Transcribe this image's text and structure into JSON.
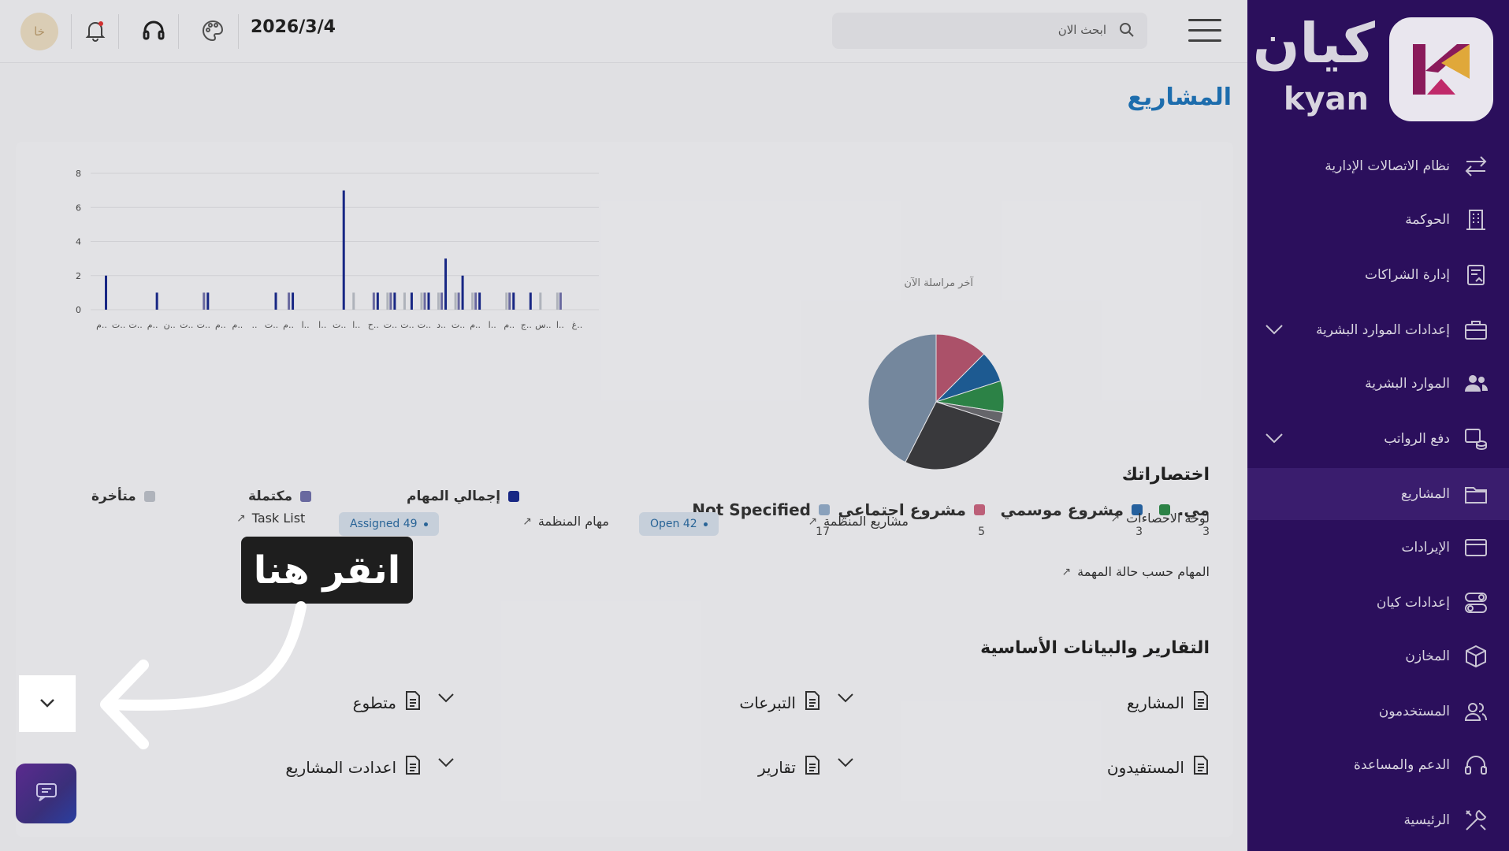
{
  "sidebar": {
    "logo_ar": "كيان",
    "logo_en": "kyan",
    "items": [
      {
        "label": "نظام الاتصالات الإدارية",
        "icon": "transfer-arrows-icon"
      },
      {
        "label": "الحوكمة",
        "icon": "building-icon"
      },
      {
        "label": "إدارة الشراكات",
        "icon": "document-house-icon"
      },
      {
        "label": "إعدادات الموارد البشرية",
        "icon": "briefcase-icon"
      },
      {
        "label": "الموارد البشرية",
        "icon": "users-icon"
      },
      {
        "label": "دفع الرواتب",
        "icon": "coins-icon"
      },
      {
        "label": "المشاريع",
        "icon": "folder-icon"
      },
      {
        "label": "الإيرادات",
        "icon": "card-icon"
      },
      {
        "label": "إعدادات كيان",
        "icon": "toggles-icon"
      },
      {
        "label": "المخازن",
        "icon": "box-icon"
      },
      {
        "label": "المستخدمون",
        "icon": "user-group-icon"
      },
      {
        "label": "الدعم والمساعدة",
        "icon": "headset-icon"
      },
      {
        "label": "الرئيسية",
        "icon": "tools-icon"
      }
    ]
  },
  "topbar": {
    "avatar_initials": "خا",
    "date": "2026/3/4",
    "search_placeholder": "ابحث الان"
  },
  "page": {
    "title": "المشاريع",
    "clipped_heading": "آخر مراسلة الآن"
  },
  "chart_data": [
    {
      "type": "bar",
      "ylim": [
        0,
        8
      ],
      "yticks": [
        "0",
        "2",
        "4",
        "6",
        "8"
      ],
      "categories": [
        "م..",
        "ت..",
        "ت..",
        "م..",
        "ن..",
        "ت..",
        "ت..",
        "م..",
        "م..",
        "..",
        "ت..",
        "م..",
        "ا..",
        "ا..",
        "ت..",
        "ا..",
        "ح..",
        "ت..",
        "ت..",
        "ت..",
        "د..",
        "ت..",
        "م..",
        "ا..",
        "م..",
        "ج..",
        "س..",
        "ا..",
        "غ.."
      ],
      "series": [
        {
          "name": "إجمالي المهام",
          "color": "#1a2a8c",
          "values": [
            2,
            0,
            0,
            1,
            0,
            0,
            1,
            0,
            0,
            0,
            1,
            1,
            0,
            0,
            7,
            0,
            1,
            1,
            1,
            1,
            3,
            2,
            1,
            0,
            1,
            1,
            0,
            0,
            0
          ]
        },
        {
          "name": "مكتملة",
          "color": "#6f6fa8",
          "values": [
            0,
            0,
            0,
            0,
            0,
            0,
            1,
            0,
            0,
            0,
            0,
            1,
            0,
            0,
            0,
            0,
            1,
            1,
            0,
            1,
            1,
            1,
            1,
            0,
            1,
            0,
            0,
            1,
            0
          ]
        },
        {
          "name": "متأخرة",
          "color": "#b9bdc6",
          "values": [
            0,
            0,
            0,
            0,
            0,
            0,
            0,
            0,
            0,
            0,
            0,
            0,
            0,
            0,
            0,
            1,
            0,
            1,
            1,
            1,
            1,
            1,
            1,
            0,
            1,
            0,
            1,
            1,
            0
          ]
        }
      ]
    },
    {
      "type": "pie",
      "slices": [
        {
          "name": "Not Specified",
          "value": 17,
          "color": "#7b8fa6"
        },
        {
          "name": "مشروع اجتماعي",
          "value": 5,
          "color": "#b5566f"
        },
        {
          "name": "مشروع موسمي",
          "value": 3,
          "color": "#1f5f99"
        },
        {
          "name": "مي..",
          "value": 3,
          "color": "#2f8a4a"
        },
        {
          "name": "",
          "value": 1,
          "color": "#6b6b70"
        },
        {
          "name": "",
          "value": 11,
          "color": "#3d3d40"
        }
      ]
    }
  ],
  "pie_legend": [
    {
      "label": "Not Specified",
      "count": "17",
      "color": "#92aac7"
    },
    {
      "label": "مشروع اجتماعي",
      "count": "5",
      "color": "#c7657f"
    },
    {
      "label": "مشروع موسمي",
      "count": "3",
      "color": "#2766a6"
    },
    {
      "label": "مي.",
      "count": "3",
      "color": "#2f8a4a"
    }
  ],
  "shortcuts": {
    "title": "اختصاراتك",
    "items": [
      {
        "label": "لوحة الاحصاءات"
      },
      {
        "label": "مشاريع المنظمة",
        "badge": "Open 42"
      },
      {
        "label": "مهام المنظمة",
        "badge": "Assigned 49"
      },
      {
        "label": "Task List"
      },
      {
        "label": "المهام حسب حالة المهمة"
      }
    ]
  },
  "reports": {
    "title": "التقارير والبيانات الأساسية",
    "items": [
      "المشاريع",
      "التبرعات",
      "متطوع",
      "المستفيدون",
      "تقارير",
      "اعدادت المشاريع"
    ]
  },
  "callout": {
    "text": "انقر هنا"
  }
}
